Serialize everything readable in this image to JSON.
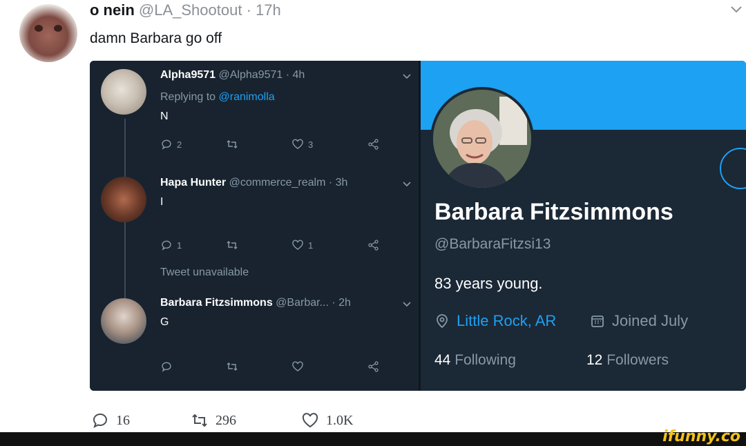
{
  "outer": {
    "name": "o nein",
    "handle": "@LA_Shootout",
    "separator": "·",
    "time": "17h",
    "text": "damn Barbara go off",
    "replies": "16",
    "retweets": "296",
    "likes": "1.0K"
  },
  "thread": {
    "tweets": [
      {
        "name": "Alpha9571",
        "handle": "@Alpha9571 · 4h",
        "replying_prefix": "Replying to",
        "replying_to": "@ranimolla",
        "text": "N",
        "replies": "2",
        "retweets": "",
        "likes": "3"
      },
      {
        "name": "Hapa Hunter",
        "handle": "@commerce_realm · 3h",
        "text": "I",
        "replies": "1",
        "retweets": "",
        "likes": "1"
      },
      {
        "name": "Barbara Fitzsimmons",
        "handle": "@Barbar... · 2h",
        "text": "G",
        "replies": "",
        "retweets": "",
        "likes": ""
      }
    ],
    "unavailable": "Tweet unavailable"
  },
  "profile": {
    "name": "Barbara Fitzsimmons",
    "handle": "@BarbaraFitzsi13",
    "bio": "83 years young.",
    "location": "Little Rock, AR",
    "joined": "Joined July",
    "following_count": "44",
    "following_label": "Following",
    "followers_count": "12",
    "followers_label": "Followers"
  },
  "watermark": "ifunny.co",
  "colors": {
    "accent": "#1da1f2",
    "dark_bg": "#1b2836",
    "muted": "#8899a6"
  }
}
